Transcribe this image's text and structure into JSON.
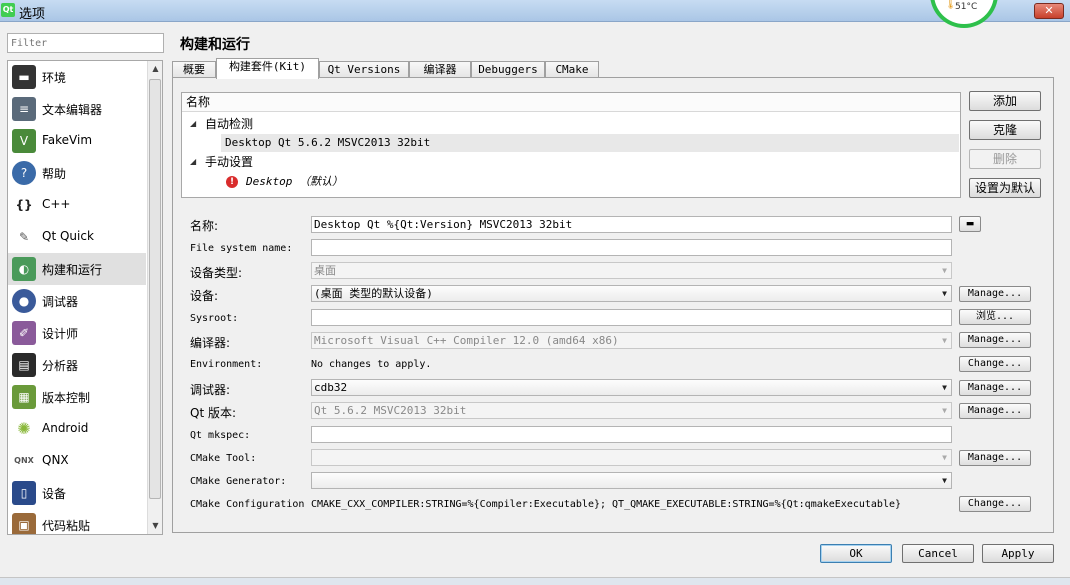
{
  "window": {
    "logo": "Qt",
    "title": "选项",
    "close": "✕"
  },
  "temp_widget": {
    "value": "51°C",
    "icon": "thermometer-icon"
  },
  "filter": {
    "placeholder": "Filter"
  },
  "categories": [
    {
      "label": "环境",
      "icon": "monitor-icon",
      "color": "#333333"
    },
    {
      "label": "文本编辑器",
      "icon": "text-doc-icon",
      "color": "#5a6a7a"
    },
    {
      "label": "FakeVim",
      "icon": "fakevim-icon",
      "color": "#4a8a3a"
    },
    {
      "label": "帮助",
      "icon": "question-icon",
      "color": "#3a6aa8"
    },
    {
      "label": "C++",
      "icon": "braces-icon",
      "color": "#2a2a2a"
    },
    {
      "label": "Qt Quick",
      "icon": "pen-icon",
      "color": "#7a7a7a"
    },
    {
      "label": "构建和运行",
      "icon": "build-run-icon",
      "color": "#4a9a5a"
    },
    {
      "label": "调试器",
      "icon": "bug-icon",
      "color": "#3a5a9a"
    },
    {
      "label": "设计师",
      "icon": "designer-icon",
      "color": "#8a5a9a"
    },
    {
      "label": "分析器",
      "icon": "analyzer-icon",
      "color": "#2a2a2a"
    },
    {
      "label": "版本控制",
      "icon": "version-control-icon",
      "color": "#6a9a3a"
    },
    {
      "label": "Android",
      "icon": "android-icon",
      "color": "#8ab83a"
    },
    {
      "label": "QNX",
      "icon": "qnx-icon",
      "color": "#555555"
    },
    {
      "label": "设备",
      "icon": "device-icon",
      "color": "#2a4a8a"
    },
    {
      "label": "代码粘贴",
      "icon": "paste-icon",
      "color": "#9a6a3a"
    }
  ],
  "selected_category": "构建和运行",
  "page_title": "构建和运行",
  "tabs": [
    {
      "label": "概要"
    },
    {
      "label": "构建套件(Kit)"
    },
    {
      "label": "Qt Versions"
    },
    {
      "label": "编译器"
    },
    {
      "label": "Debuggers"
    },
    {
      "label": "CMake"
    }
  ],
  "active_tab": "构建套件(Kit)",
  "kit_tree": {
    "header": "名称",
    "auto_group": "自动检测",
    "auto_kit": "Desktop Qt 5.6.2 MSVC2013 32bit",
    "manual_group": "手动设置",
    "manual_kit": "Desktop （默认）",
    "error_mark": "!"
  },
  "kit_buttons": {
    "add": "添加",
    "clone": "克隆",
    "remove": "删除",
    "make_default": "设置为默认"
  },
  "form": {
    "name_label": "名称:",
    "name_value": "Desktop Qt %{Qt:Version} MSVC2013 32bit",
    "fs_label": "File system name:",
    "fs_value": "",
    "device_type_label": "设备类型:",
    "device_type_value": "桌面",
    "device_label": "设备:",
    "device_value": "(桌面 类型的默认设备)",
    "sysroot_label": "Sysroot:",
    "sysroot_value": "",
    "compiler_label": "编译器:",
    "compiler_value": "Microsoft Visual C++ Compiler 12.0 (amd64 x86)",
    "env_label": "Environment:",
    "env_value": "No changes to apply.",
    "debugger_label": "调试器:",
    "debugger_value": "cdb32",
    "qt_version_label": "Qt 版本:",
    "qt_version_value": "Qt 5.6.2 MSVC2013 32bit",
    "mkspec_label": "Qt mkspec:",
    "mkspec_value": "",
    "cmake_tool_label": "CMake Tool:",
    "cmake_tool_value": "",
    "cmake_gen_label": "CMake Generator:",
    "cmake_gen_value": "",
    "cmake_config_label": "CMake Configuration",
    "cmake_config_value": "CMAKE_CXX_COMPILER:STRING=%{Compiler:Executable}; QT_QMAKE_EXECUTABLE:STRING=%{Qt:qmakeExecutable}"
  },
  "side_buttons": {
    "manage": "Manage...",
    "browse": "浏览...",
    "change": "Change..."
  },
  "footer": {
    "ok": "OK",
    "cancel": "Cancel",
    "apply": "Apply"
  }
}
